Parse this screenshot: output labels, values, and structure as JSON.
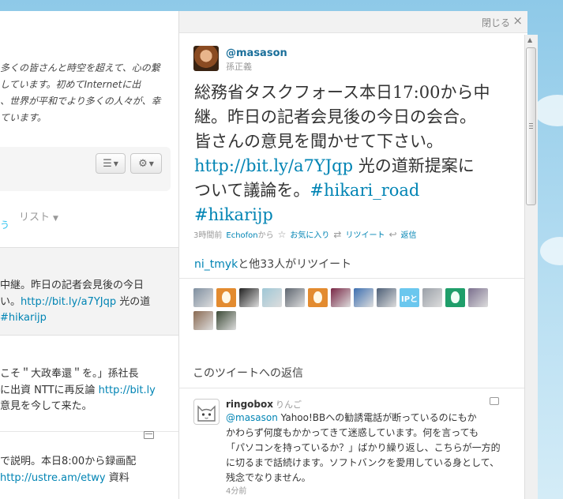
{
  "left": {
    "bio_lines": [
      "多くの皆さんと時空を超えて、心の繋",
      "しています。初めてInternetに出",
      "、世界が平和でより多くの人々が、幸",
      "ています。"
    ],
    "list_tab": "リスト",
    "blue_mark": "う",
    "tweet1_lines": [
      {
        "text": "中継。昨日の記者会見後の今日",
        "link": ""
      },
      {
        "text": "い。",
        "link": "http://bit.ly/a7YJqp",
        "after": " 光の道"
      },
      {
        "text": "",
        "link": "#hikarijp",
        "after": ""
      }
    ],
    "tweet2_lines": [
      {
        "text": "こそ＂大政奉還＂を。」孫社長",
        "link": ""
      },
      {
        "text": "に出資  NTTに再反論 ",
        "link": "http://bit.ly",
        "after": ""
      },
      {
        "text": "意見を今して来た。",
        "link": ""
      }
    ],
    "tweet3_lines": [
      {
        "text": "で説明。本日8:00から録画配",
        "link": ""
      },
      {
        "text": "",
        "link": "http://ustre.am/etwy",
        "after": " 資料"
      }
    ]
  },
  "pane": {
    "close_label": "閉じる",
    "close_x": "×",
    "screen_name": "@masason",
    "real_name": "孫正義",
    "tweet_lines": [
      {
        "text": "総務省タスクフォース本日17:00から中",
        "link": "",
        "after": ""
      },
      {
        "text": "継。昨日の記者会見後の今日の会合。",
        "link": "",
        "after": ""
      },
      {
        "text": "皆さんの意見を聞かせて下さい。",
        "link": "",
        "after": ""
      },
      {
        "text": "",
        "link": "http://bit.ly/a7YJqp",
        "after": " 光の道新提案に"
      },
      {
        "text": "ついて議論を。",
        "link": "#hikari_road",
        "after": ""
      },
      {
        "text": "",
        "link": "#hikarijp",
        "after": ""
      }
    ],
    "meta": {
      "time": "3時間前",
      "client": "Echofon",
      "client_suffix": "から",
      "favorite": "お気に入り",
      "retweet": "リツイート",
      "reply": "返信"
    },
    "retweeted_by": {
      "user": "ni_tmyk",
      "text": "と他33人がリツイート"
    },
    "rt_avatars": [
      {
        "kind": "photo",
        "color": "#7f8fa0"
      },
      {
        "kind": "egg"
      },
      {
        "kind": "photo",
        "color": "#222222"
      },
      {
        "kind": "photo",
        "color": "#9fc7d6"
      },
      {
        "kind": "photo",
        "color": "#5e6670"
      },
      {
        "kind": "egg"
      },
      {
        "kind": "photo",
        "color": "#7a2846"
      },
      {
        "kind": "photo",
        "color": "#3d6fb0"
      },
      {
        "kind": "photo",
        "color": "#4d5f77"
      },
      {
        "kind": "ip",
        "label": "IPと"
      },
      {
        "kind": "photo",
        "color": "#9aa0a8"
      },
      {
        "kind": "egg2"
      },
      {
        "kind": "photo",
        "color": "#7b6f8e"
      },
      {
        "kind": "photo",
        "color": "#8a6a52"
      },
      {
        "kind": "photo",
        "color": "#3c4a36"
      }
    ],
    "replies_title": "このツイートへの返信",
    "reply": {
      "screen_name": "ringobox",
      "real_name": "りんご",
      "mention": "@masason",
      "lines": [
        " Yahoo!BBへの勧誘電話が断っているのにもか",
        "かわらず何度もかかってきて迷惑しています。何を言っても",
        "「パソコンを持っているか？」ばかり繰り返し、こちらが一方的",
        "に切るまで話続けます。ソフトバンクを愛用している身として、",
        "残念でなりません。"
      ],
      "time": "4分前"
    }
  }
}
